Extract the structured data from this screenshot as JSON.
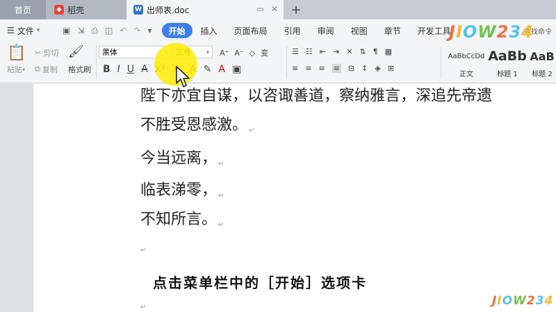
{
  "tabs": {
    "home": "首页",
    "daoke": "稻壳",
    "doc": "出师表.doc"
  },
  "menu": {
    "file": "文件",
    "items": [
      "开始",
      "插入",
      "页面布局",
      "引用",
      "审阅",
      "视图",
      "章节",
      "开发工具"
    ],
    "active": "开始",
    "search": "查找命令"
  },
  "ribbon": {
    "paste": "粘贴",
    "cut": "剪切",
    "copy": "复制",
    "format_painter": "格式刷",
    "font": "黑体",
    "size": "三号",
    "styles": [
      {
        "sample": "AaBbCcDd",
        "name": "正文"
      },
      {
        "sample": "AaBb",
        "name": "标题 1"
      },
      {
        "sample": "AaB",
        "name": "标题 2"
      }
    ]
  },
  "document": {
    "lines": [
      "陛下亦宜自谋，以咨诹善道，察纳雅言，深追先帝遗",
      "不胜受恩感激。",
      "今当远离，",
      "临表涕零，",
      "不知所言。"
    ]
  },
  "subtitle": "点击菜单栏中的［开始］选项卡",
  "watermark": "JIOW234",
  "colors": {
    "accent": "#3c7ef0",
    "highlight": "#ffec00"
  }
}
